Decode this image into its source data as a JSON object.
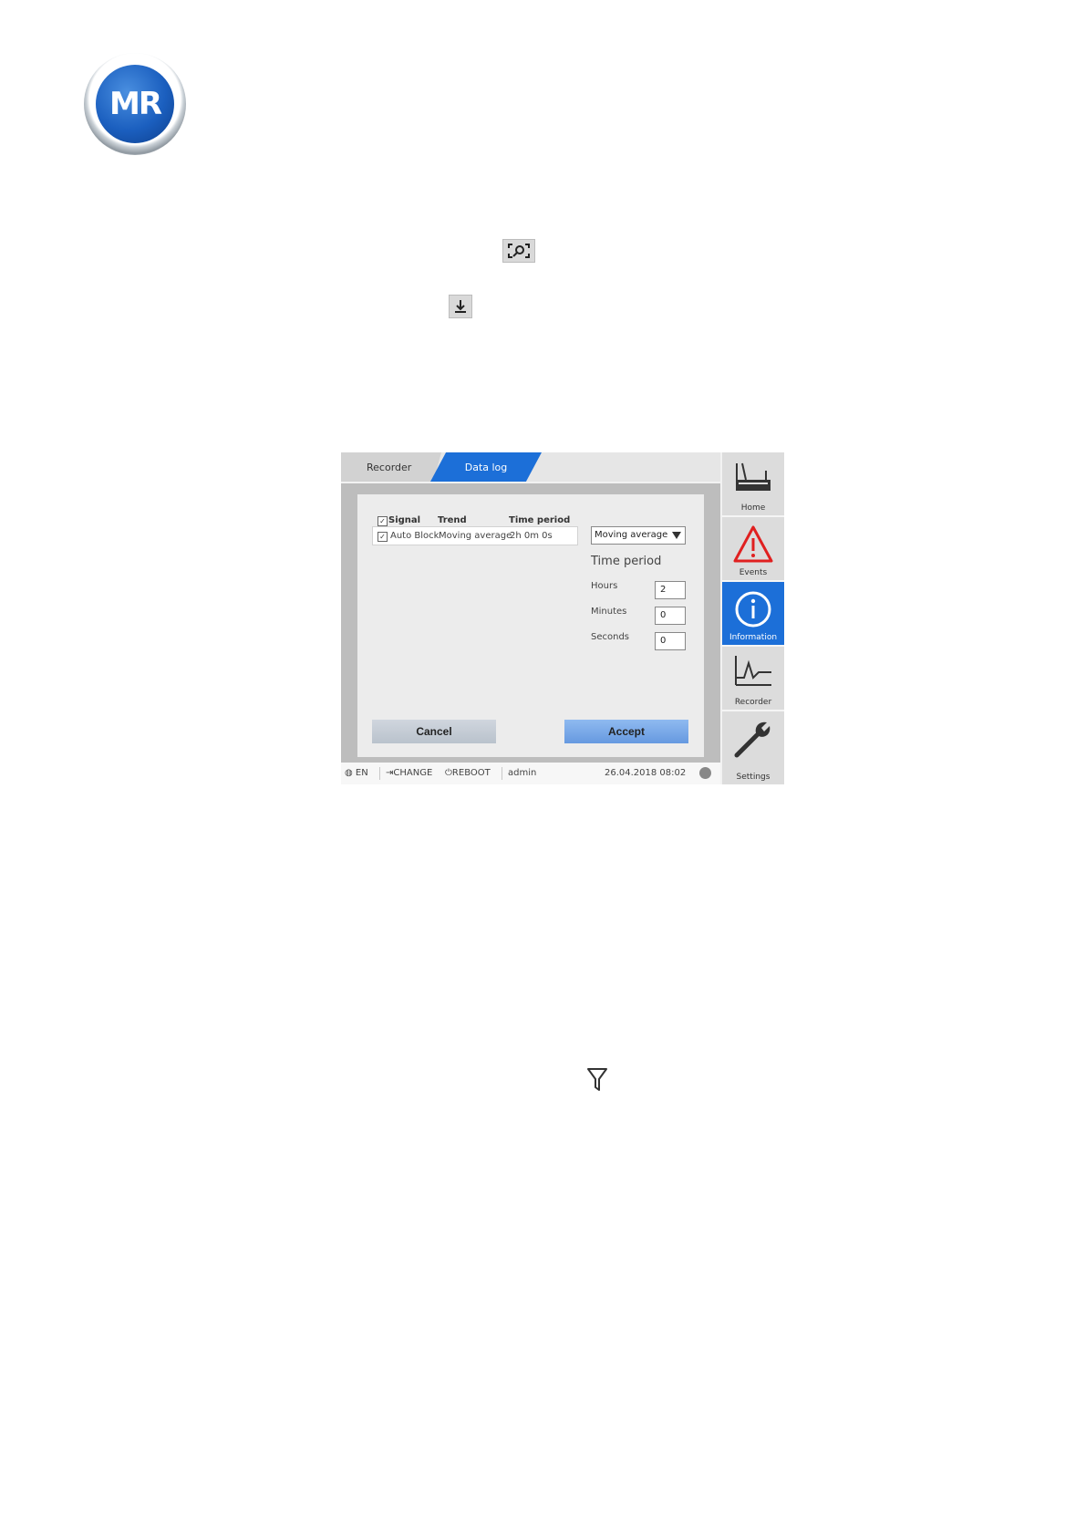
{
  "logo": {
    "text": "MR"
  },
  "screen": {
    "tabs": [
      {
        "label": "Recorder"
      },
      {
        "label": "Data log"
      }
    ],
    "table": {
      "headers": {
        "signal": "Signal",
        "trend": "Trend",
        "time_period": "Time period"
      },
      "rows": [
        {
          "signal": "Auto Block",
          "trend": "Moving average",
          "time_period": "2h 0m 0s",
          "checked": true
        }
      ]
    },
    "trend_select": {
      "value": "Moving average"
    },
    "time_period": {
      "title": "Time period",
      "hours_label": "Hours",
      "hours_value": "2",
      "minutes_label": "Minutes",
      "minutes_value": "0",
      "seconds_label": "Seconds",
      "seconds_value": "0"
    },
    "buttons": {
      "cancel": "Cancel",
      "accept": "Accept"
    },
    "status": {
      "language": "EN",
      "change": "CHANGE",
      "reboot": "REBOOT",
      "user": "admin",
      "datetime": "26.04.2018 08:02"
    },
    "nav": [
      {
        "label": "Home",
        "icon": "home-device-icon"
      },
      {
        "label": "Events",
        "icon": "warning-triangle-icon"
      },
      {
        "label": "Information",
        "icon": "info-circle-icon",
        "active": true
      },
      {
        "label": "Recorder",
        "icon": "chart-line-icon"
      },
      {
        "label": "Settings",
        "icon": "wrench-icon"
      }
    ],
    "accent_color": "#1c6fd8",
    "warning_color": "#e02020"
  }
}
